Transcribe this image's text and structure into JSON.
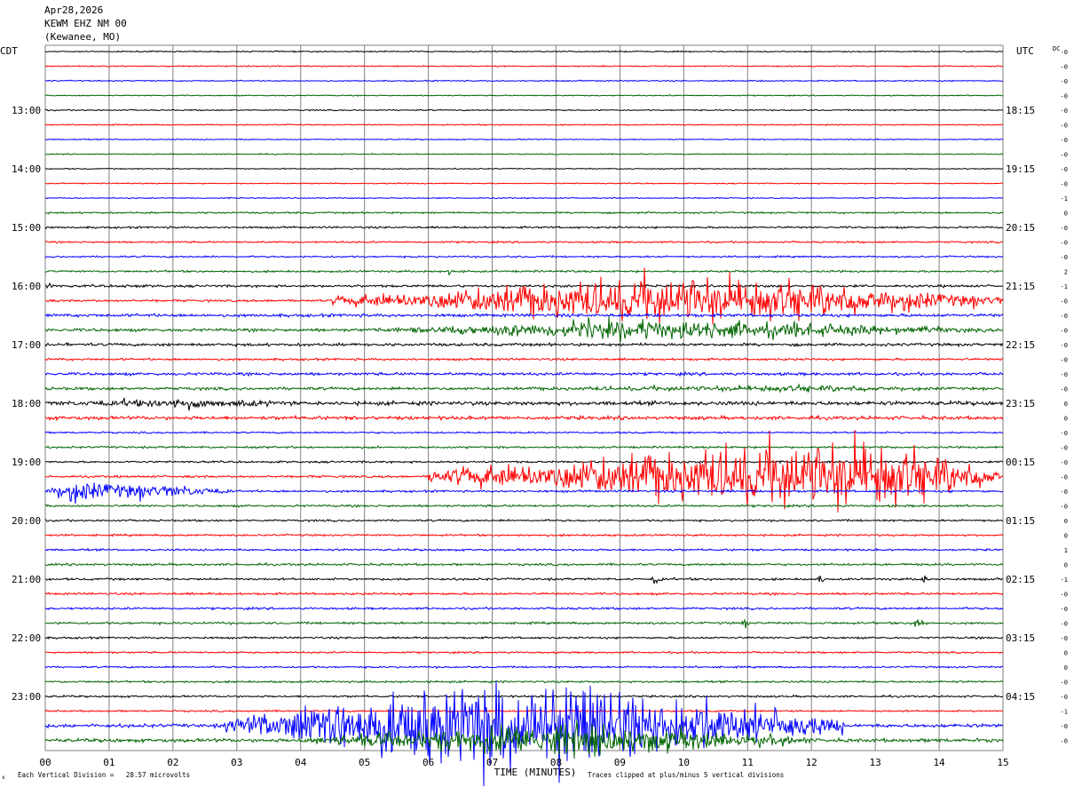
{
  "header": {
    "date": "Apr28,2026",
    "station": "KEWM EHZ NM 00",
    "location": "(Kewanee, MO)"
  },
  "axis": {
    "left_tz": "CDT",
    "right_tz": "UTC",
    "dc_label": "DC",
    "xlabel": "TIME (MINUTES)"
  },
  "footer": {
    "scale": "Each Vertical Division =   28.57 microvolts",
    "clip_note": "Traces clipped at plus/minus 5 vertical divisions",
    "corner_mark": "x"
  },
  "colors": {
    "trace_cycle": [
      "#000000",
      "#ff0000",
      "#0000ff",
      "#006400"
    ],
    "grid": "#808080",
    "background": "#ffffff"
  },
  "chart_data": {
    "type": "line",
    "title": "",
    "x": {
      "min": 0,
      "max": 15,
      "unit": "minutes",
      "tick_labels": [
        "00",
        "01",
        "02",
        "03",
        "04",
        "05",
        "06",
        "07",
        "08",
        "09",
        "10",
        "11",
        "12",
        "13",
        "14",
        "15"
      ]
    },
    "rows_per_hour": 4,
    "left_hour_labels": [
      {
        "row": 4,
        "text": "13:00"
      },
      {
        "row": 8,
        "text": "14:00"
      },
      {
        "row": 12,
        "text": "15:00"
      },
      {
        "row": 16,
        "text": "16:00"
      },
      {
        "row": 20,
        "text": "17:00"
      },
      {
        "row": 24,
        "text": "18:00"
      },
      {
        "row": 28,
        "text": "19:00"
      },
      {
        "row": 32,
        "text": "20:00"
      },
      {
        "row": 36,
        "text": "21:00"
      },
      {
        "row": 40,
        "text": "22:00"
      },
      {
        "row": 44,
        "text": "23:00"
      }
    ],
    "right_hour_labels": [
      {
        "row": 4,
        "text": "18:15"
      },
      {
        "row": 8,
        "text": "19:15"
      },
      {
        "row": 12,
        "text": "20:15"
      },
      {
        "row": 16,
        "text": "21:15"
      },
      {
        "row": 20,
        "text": "22:15"
      },
      {
        "row": 24,
        "text": "23:15"
      },
      {
        "row": 28,
        "text": "00:15"
      },
      {
        "row": 32,
        "text": "01:15"
      },
      {
        "row": 36,
        "text": "02:15"
      },
      {
        "row": 40,
        "text": "03:15"
      },
      {
        "row": 44,
        "text": "04:15"
      }
    ],
    "dc_offsets": [
      "-0",
      "-0",
      "-0",
      "-0",
      "-0",
      "-0",
      "-0",
      "-0",
      "-0",
      "-0",
      "-1",
      "0",
      "-0",
      "-0",
      "-0",
      "2",
      "-1",
      "-0",
      "-0",
      "-0",
      "-0",
      "-0",
      "-0",
      "-0",
      "0",
      "0",
      "-0",
      "-0",
      "-0",
      "-0",
      "-0",
      "-0",
      "0",
      "0",
      "1",
      "0",
      "-1",
      "-0",
      "-0",
      "-0",
      "-0",
      "0",
      "0",
      "-0",
      "-0",
      "-1",
      "-0",
      "-0"
    ],
    "noise": [
      0.55,
      0.55,
      0.55,
      0.5,
      0.55,
      0.55,
      0.5,
      0.5,
      0.5,
      0.5,
      0.5,
      0.8,
      0.9,
      0.8,
      0.8,
      0.9,
      1.1,
      1.0,
      1.4,
      1.4,
      1.3,
      1.0,
      1.3,
      1.3,
      1.8,
      1.6,
      0.8,
      0.9,
      0.9,
      1.0,
      1.0,
      1.0,
      0.9,
      0.9,
      0.9,
      1.0,
      1.0,
      1.0,
      1.0,
      1.0,
      0.9,
      0.8,
      0.8,
      0.9,
      0.9,
      0.8,
      1.6,
      1.6
    ],
    "events": [
      {
        "row": 15,
        "start": 6.3,
        "end": 6.7,
        "amp": 6,
        "shape": "burst"
      },
      {
        "row": 16,
        "start": 0.0,
        "end": 0.5,
        "amp": 5,
        "shape": "burst"
      },
      {
        "row": 16,
        "start": 1.2,
        "end": 1.5,
        "amp": 6,
        "shape": "burst"
      },
      {
        "row": 17,
        "start": 4.5,
        "end": 15.0,
        "amp": 30,
        "peak": 10.2,
        "shape": "tremor"
      },
      {
        "row": 19,
        "start": 5.0,
        "end": 15.0,
        "amp": 12,
        "peak": 9.5,
        "shape": "tremor"
      },
      {
        "row": 20,
        "start": 0.0,
        "end": 0.6,
        "amp": 5,
        "shape": "burst"
      },
      {
        "row": 23,
        "start": 5.5,
        "end": 15.0,
        "amp": 4,
        "peak": 12.0,
        "shape": "tremor"
      },
      {
        "row": 24,
        "start": 0.0,
        "end": 4.5,
        "amp": 6,
        "peak": 2.0,
        "shape": "tremor"
      },
      {
        "row": 29,
        "start": 6.0,
        "end": 15.0,
        "amp": 45,
        "peak": 12.8,
        "shape": "tremor"
      },
      {
        "row": 30,
        "start": 0.0,
        "end": 3.0,
        "amp": 13,
        "peak": 0.4,
        "shape": "tremor"
      },
      {
        "row": 36,
        "start": 9.5,
        "end": 9.9,
        "amp": 12,
        "shape": "burst"
      },
      {
        "row": 36,
        "start": 12.1,
        "end": 12.4,
        "amp": 10,
        "shape": "burst"
      },
      {
        "row": 36,
        "start": 13.7,
        "end": 14.1,
        "amp": 9,
        "shape": "burst"
      },
      {
        "row": 39,
        "start": 10.9,
        "end": 11.2,
        "amp": 10,
        "shape": "burst"
      },
      {
        "row": 39,
        "start": 13.6,
        "end": 14.0,
        "amp": 14,
        "shape": "burst"
      },
      {
        "row": 46,
        "start": 2.8,
        "end": 12.5,
        "amp": 55,
        "peak": 7.3,
        "shape": "tremor"
      },
      {
        "row": 47,
        "start": 4.0,
        "end": 12.0,
        "amp": 20,
        "peak": 8.0,
        "shape": "tremor"
      }
    ]
  }
}
